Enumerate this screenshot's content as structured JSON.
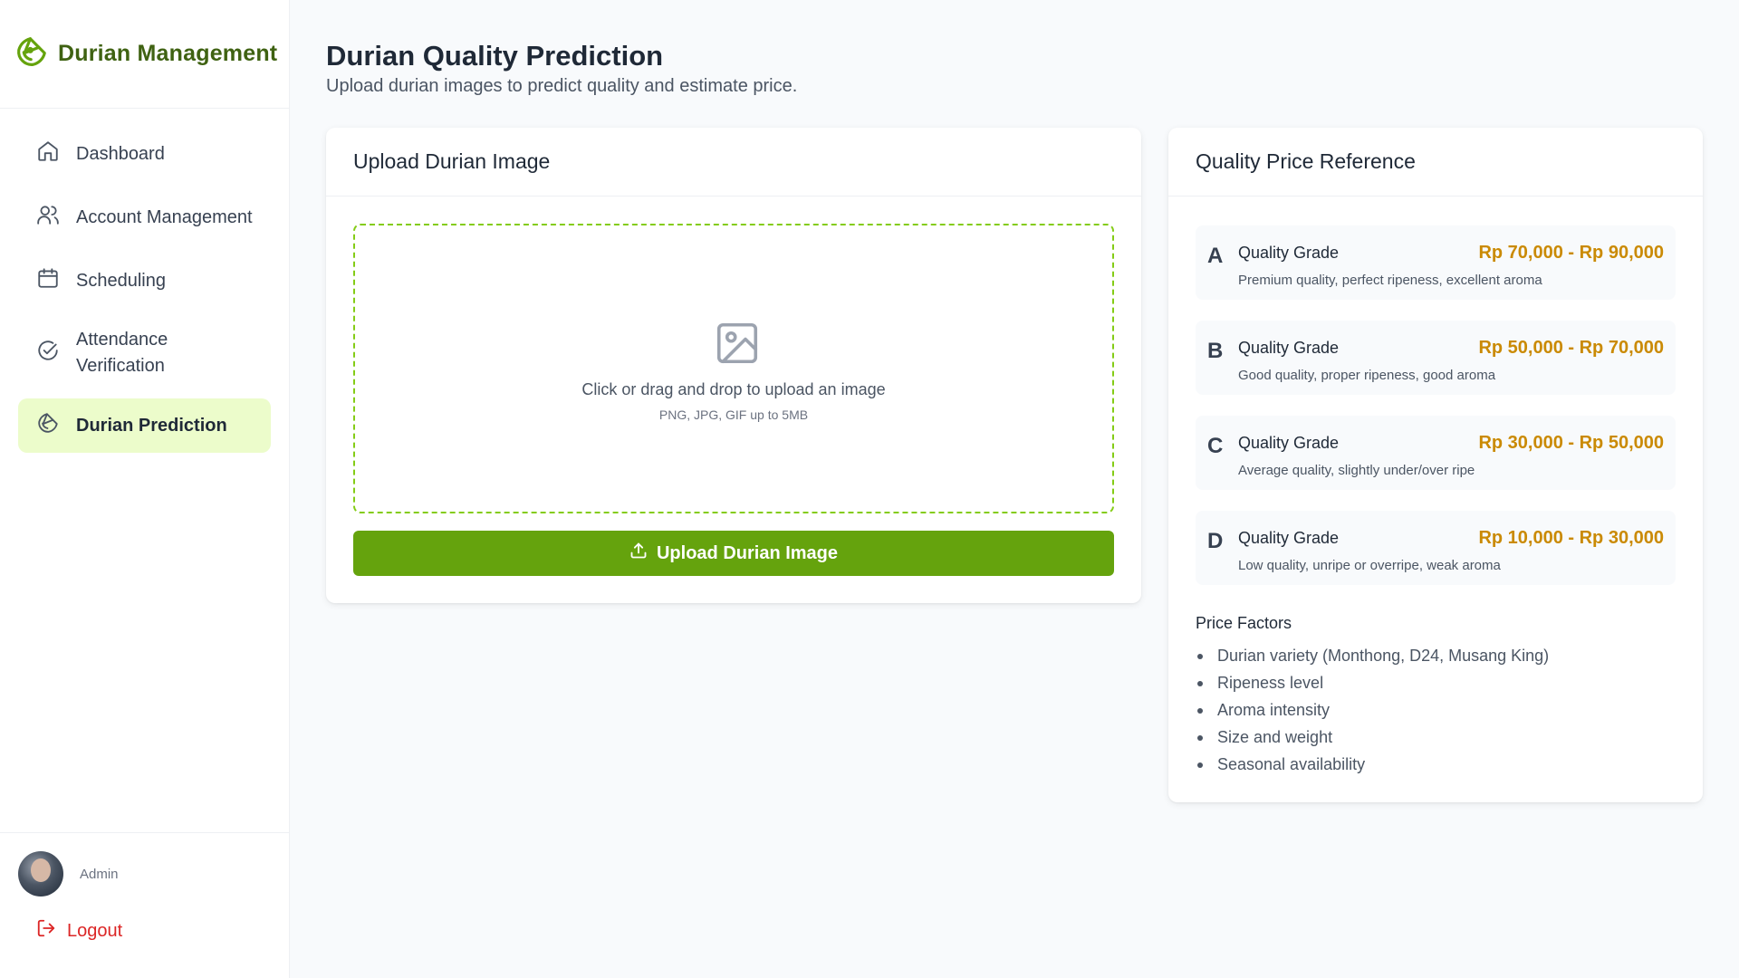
{
  "brand": {
    "title": "Durian Management",
    "icon": "durian-logo-icon",
    "accent": "#3f6212"
  },
  "sidebar": {
    "items": [
      {
        "label": "Dashboard",
        "icon": "home-icon"
      },
      {
        "label": "Account Management",
        "icon": "users-icon"
      },
      {
        "label": "Scheduling",
        "icon": "calendar-icon"
      },
      {
        "label": "Attendance Verification",
        "icon": "check-circle-icon"
      },
      {
        "label": "Durian Prediction",
        "icon": "durian-icon",
        "active": true
      }
    ],
    "active_bg": "#ecfccb"
  },
  "user": {
    "name": "Admin",
    "logout_label": "Logout",
    "logout_color": "#dc2626"
  },
  "page": {
    "title": "Durian Quality Prediction",
    "subtitle": "Upload durian images to predict quality and estimate price."
  },
  "upload": {
    "card_title": "Upload Durian Image",
    "dropzone_text": "Click or drag and drop to upload an image",
    "dropzone_hint": "PNG, JPG, GIF up to 5MB",
    "button_label": "Upload Durian Image",
    "button_color": "#65a30d",
    "dropzone_border_color": "#84cc16"
  },
  "reference": {
    "card_title": "Quality Price Reference",
    "grades": [
      {
        "letter": "A",
        "label": "Quality Grade",
        "price": "Rp 70,000 - Rp 90,000",
        "desc": "Premium quality, perfect ripeness, excellent aroma"
      },
      {
        "letter": "B",
        "label": "Quality Grade",
        "price": "Rp 50,000 - Rp 70,000",
        "desc": "Good quality, proper ripeness, good aroma"
      },
      {
        "letter": "C",
        "label": "Quality Grade",
        "price": "Rp 30,000 - Rp 50,000",
        "desc": "Average quality, slightly under/over ripe"
      },
      {
        "letter": "D",
        "label": "Quality Grade",
        "price": "Rp 10,000 - Rp 30,000",
        "desc": "Low quality, unripe or overripe, weak aroma"
      }
    ],
    "price_color": "#ca8a04",
    "factors_title": "Price Factors",
    "factors": [
      "Durian variety (Monthong, D24, Musang King)",
      "Ripeness level",
      "Aroma intensity",
      "Size and weight",
      "Seasonal availability"
    ]
  }
}
